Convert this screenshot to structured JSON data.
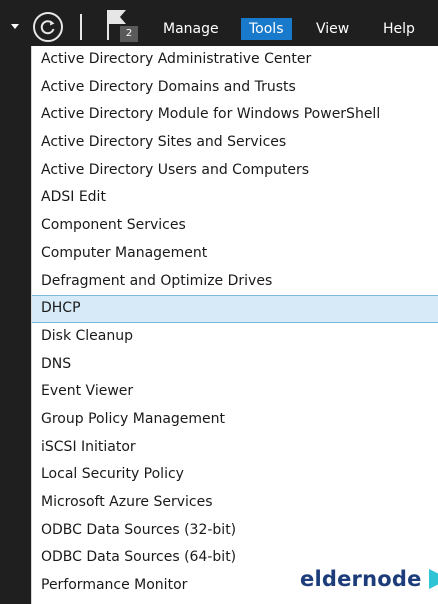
{
  "menubar": {
    "notification_count": "2",
    "menus": [
      {
        "label": "Manage",
        "active": false
      },
      {
        "label": "Tools",
        "active": true
      },
      {
        "label": "View",
        "active": false
      },
      {
        "label": "Help",
        "active": false
      }
    ]
  },
  "tools_menu": {
    "items": [
      "Active Directory Administrative Center",
      "Active Directory Domains and Trusts",
      "Active Directory Module for Windows PowerShell",
      "Active Directory Sites and Services",
      "Active Directory Users and Computers",
      "ADSI Edit",
      "Component Services",
      "Computer Management",
      "Defragment and Optimize Drives",
      "DHCP",
      "Disk Cleanup",
      "DNS",
      "Event Viewer",
      "Group Policy Management",
      "iSCSI Initiator",
      "Local Security Policy",
      "Microsoft Azure Services",
      "ODBC Data Sources (32-bit)",
      "ODBC Data Sources (64-bit)",
      "Performance Monitor"
    ],
    "highlighted": "DHCP"
  },
  "watermark": {
    "text": "eldernode"
  },
  "colors": {
    "menubar_bg": "#1f1f1f",
    "active_menu": "#1979ca",
    "highlight_bg": "#d6ebf7",
    "highlight_border": "#7fb7dd",
    "logo": "#1c3d7a"
  },
  "icons": {
    "dropdown": "triangle-down-icon",
    "refresh": "refresh-icon",
    "notifications": "flag-icon",
    "logo_mark": "play-arrow-icon"
  }
}
